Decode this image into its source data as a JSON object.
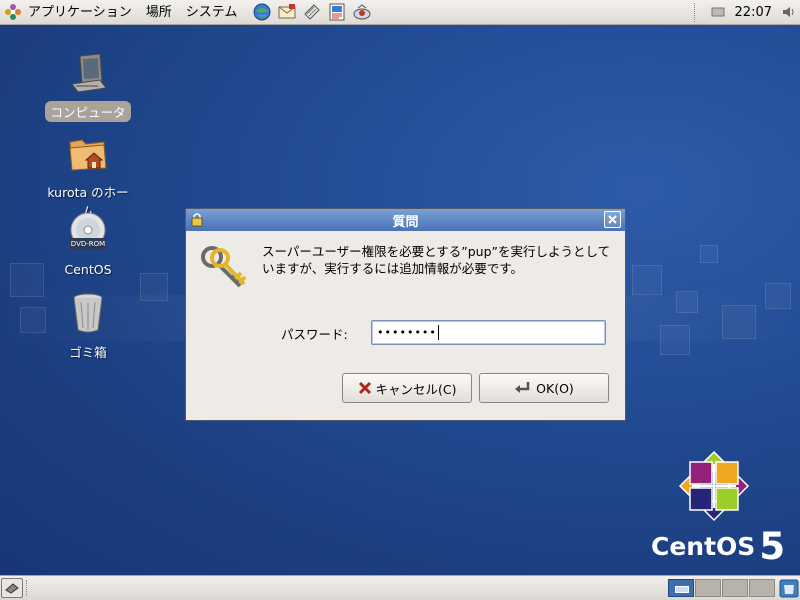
{
  "top_panel": {
    "menus": [
      "アプリケーション",
      "場所",
      "システム"
    ],
    "launchers": [
      "web-browser-icon",
      "mail-icon",
      "text-editor-icon",
      "office-icon",
      "photo-icon"
    ],
    "clock": "22:07"
  },
  "desktop_icons": [
    {
      "label": "コンピュータ",
      "icon": "computer-icon",
      "selected": true
    },
    {
      "label": "kurota のホーム",
      "icon": "home-folder-icon",
      "selected": false
    },
    {
      "label": "CentOS",
      "icon": "dvd-icon",
      "selected": false
    },
    {
      "label": "ゴミ箱",
      "icon": "trash-icon",
      "selected": false
    }
  ],
  "dvd_label": "DVD-ROM",
  "dialog": {
    "title": "質問",
    "message_line1": "スーパーユーザー権限を必要とする”pup”を実行しようとして",
    "message_line2": "いますが、実行するには追加情報が必要です。",
    "password_label": "パスワード:",
    "password_value": "••••••••",
    "cancel_label": "キャンセル(C)",
    "ok_label": "OK(O)"
  },
  "brand": {
    "name": "CentOS",
    "version": "5"
  },
  "workspaces": {
    "count": 4,
    "active": 1
  },
  "colors": {
    "desktop": "#22478c",
    "titlebar": "#4a72b6",
    "panel": "#dedbd6"
  }
}
